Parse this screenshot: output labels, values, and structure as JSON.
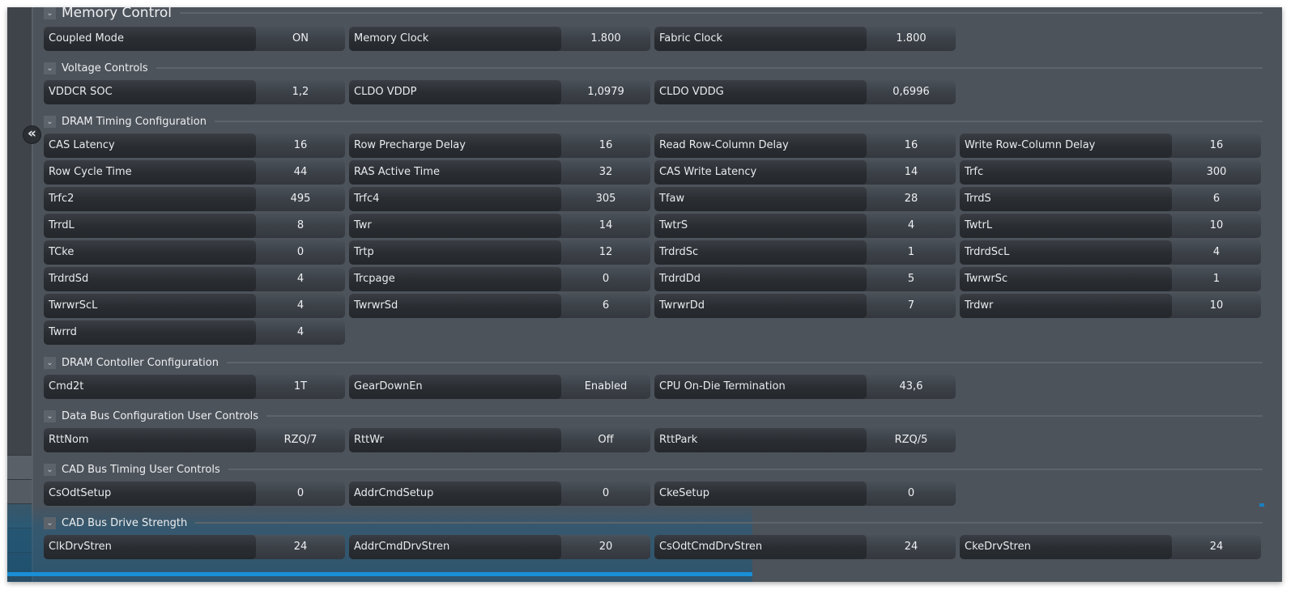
{
  "sidebar": {
    "collapse_icon": "«"
  },
  "sections": [
    {
      "title": "Memory Control",
      "fields": [
        {
          "label": "Coupled Mode",
          "value": "ON"
        },
        {
          "label": "Memory Clock",
          "value": "1.800"
        },
        {
          "label": "Fabric Clock",
          "value": "1.800"
        }
      ]
    },
    {
      "title": "Voltage Controls",
      "fields": [
        {
          "label": "VDDCR SOC",
          "value": "1,2"
        },
        {
          "label": "CLDO VDDP",
          "value": "1,0979"
        },
        {
          "label": "CLDO VDDG",
          "value": "0,6996"
        }
      ]
    },
    {
      "title": "DRAM Timing Configuration",
      "fields": [
        {
          "label": "CAS Latency",
          "value": "16"
        },
        {
          "label": "Row Precharge Delay",
          "value": "16"
        },
        {
          "label": "Read Row-Column Delay",
          "value": "16"
        },
        {
          "label": "Write Row-Column Delay",
          "value": "16"
        },
        {
          "label": "Row Cycle Time",
          "value": "44"
        },
        {
          "label": "RAS Active Time",
          "value": "32"
        },
        {
          "label": "CAS Write Latency",
          "value": "14"
        },
        {
          "label": "Trfc",
          "value": "300"
        },
        {
          "label": "Trfc2",
          "value": "495"
        },
        {
          "label": "Trfc4",
          "value": "305"
        },
        {
          "label": "Tfaw",
          "value": "28"
        },
        {
          "label": "TrrdS",
          "value": "6"
        },
        {
          "label": "TrrdL",
          "value": "8"
        },
        {
          "label": "Twr",
          "value": "14"
        },
        {
          "label": "TwtrS",
          "value": "4"
        },
        {
          "label": "TwtrL",
          "value": "10"
        },
        {
          "label": "TCke",
          "value": "0"
        },
        {
          "label": "Trtp",
          "value": "12"
        },
        {
          "label": "TrdrdSc",
          "value": "1"
        },
        {
          "label": "TrdrdScL",
          "value": "4"
        },
        {
          "label": "TrdrdSd",
          "value": "4"
        },
        {
          "label": "Trcpage",
          "value": "0"
        },
        {
          "label": "TrdrdDd",
          "value": "5"
        },
        {
          "label": "TwrwrSc",
          "value": "1"
        },
        {
          "label": "TwrwrScL",
          "value": "4"
        },
        {
          "label": "TwrwrSd",
          "value": "6"
        },
        {
          "label": "TwrwrDd",
          "value": "7"
        },
        {
          "label": "Trdwr",
          "value": "10"
        },
        {
          "label": "Twrrd",
          "value": "4"
        }
      ]
    },
    {
      "title": "DRAM Contoller Configuration",
      "fields": [
        {
          "label": "Cmd2t",
          "value": "1T"
        },
        {
          "label": "GearDownEn",
          "value": "Enabled"
        },
        {
          "label": "CPU On-Die Termination",
          "value": "43,6"
        }
      ]
    },
    {
      "title": "Data Bus Configuration User Controls",
      "fields": [
        {
          "label": "RttNom",
          "value": "RZQ/7"
        },
        {
          "label": "RttWr",
          "value": "Off"
        },
        {
          "label": "RttPark",
          "value": "RZQ/5"
        }
      ]
    },
    {
      "title": "CAD Bus Timing User Controls",
      "fields": [
        {
          "label": "CsOdtSetup",
          "value": "0"
        },
        {
          "label": "AddrCmdSetup",
          "value": "0"
        },
        {
          "label": "CkeSetup",
          "value": "0"
        }
      ]
    },
    {
      "title": "CAD Bus Drive Strength",
      "fields": [
        {
          "label": "ClkDrvStren",
          "value": "24"
        },
        {
          "label": "AddrCmdDrvStren",
          "value": "20"
        },
        {
          "label": "CsOdtCmdDrvStren",
          "value": "24"
        },
        {
          "label": "CkeDrvStren",
          "value": "24"
        }
      ]
    }
  ]
}
